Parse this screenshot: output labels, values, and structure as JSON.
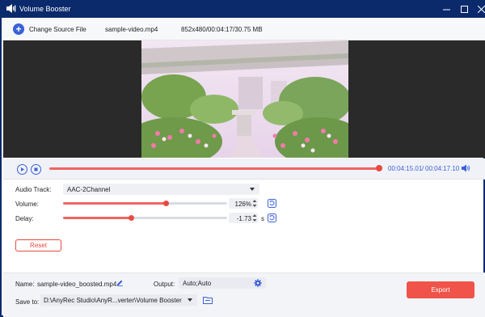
{
  "window": {
    "title": "Volume Booster"
  },
  "toolbar": {
    "change_source_label": "Change Source File",
    "file_name": "sample-video.mp4",
    "file_info": "852x480/00:04:17/30.75 MB"
  },
  "player": {
    "current_time": "00:04:15.01",
    "separator": "/",
    "total_time": "00:04:17.10",
    "progress": 0.99
  },
  "settings": {
    "audio_track_label": "Audio Track:",
    "audio_track_value": "AAC-2Channel",
    "volume_label": "Volume:",
    "volume_value": "126%",
    "volume_level": 0.63,
    "delay_label": "Delay:",
    "delay_value": "-1.73",
    "delay_unit": "s",
    "delay_level": 0.41,
    "reset_label": "Reset"
  },
  "output": {
    "name_label": "Name:",
    "name_value": "sample-video_boosted.mp4",
    "output_label": "Output:",
    "output_value": "Auto;Auto",
    "save_to_label": "Save to:",
    "save_to_value": "D:\\AnyRec Studio\\AnyR...verter\\Volume Booster",
    "export_label": "Export"
  },
  "colors": {
    "titlebar": "#0b2a6b",
    "accent_blue": "#3a62d7",
    "accent_red": "#e9493f",
    "export_button": "#f0534a"
  }
}
